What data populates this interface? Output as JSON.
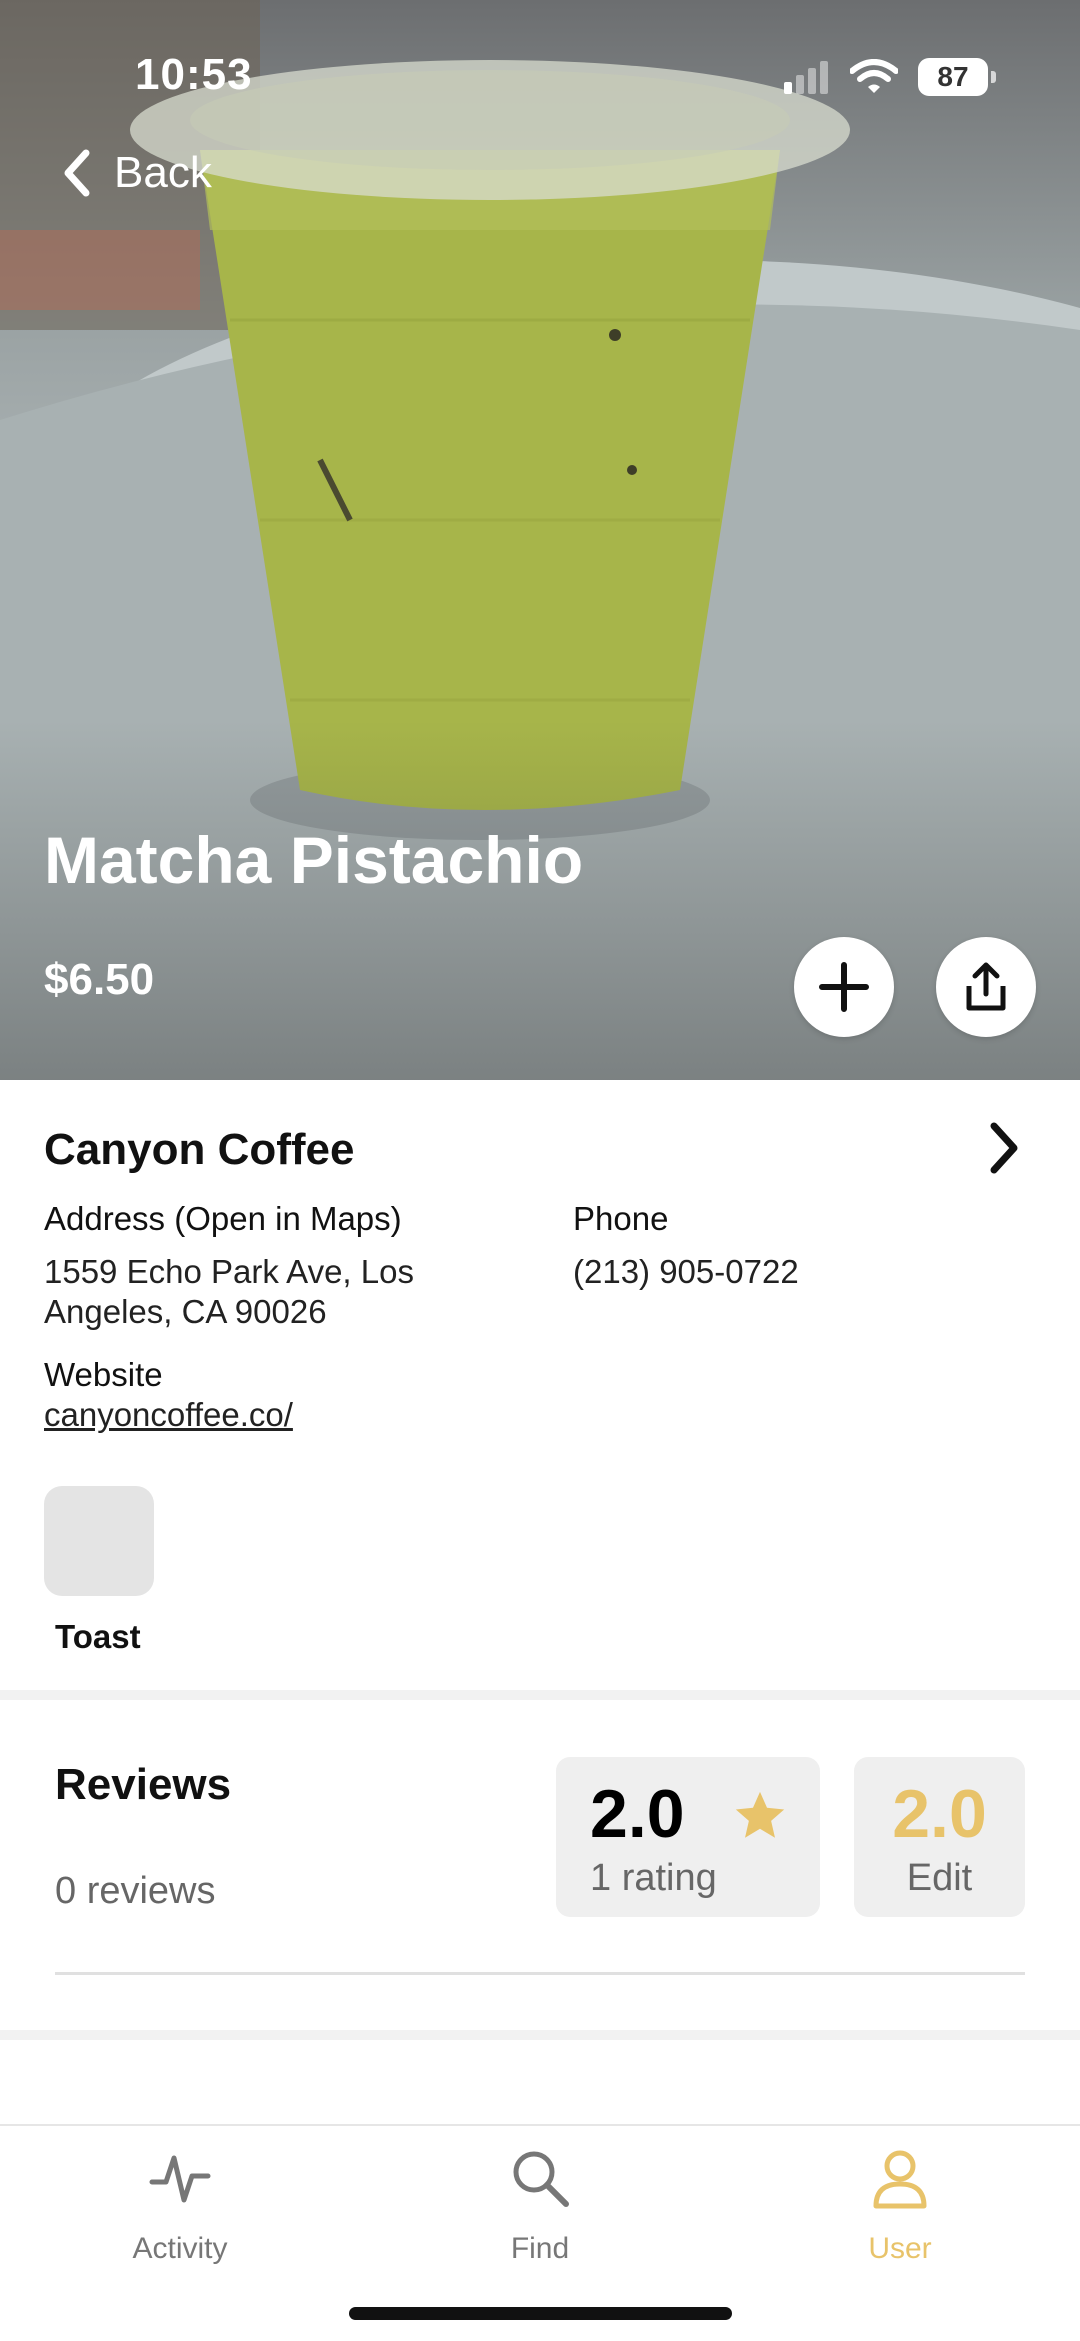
{
  "status_bar": {
    "time": "10:53",
    "battery": "87"
  },
  "nav": {
    "back_label": "Back"
  },
  "item": {
    "name": "Matcha Pistachio",
    "price": "$6.50"
  },
  "actions": {
    "add_icon": "plus-icon",
    "share_icon": "share-icon"
  },
  "shop": {
    "name": "Canyon Coffee",
    "address_label": "Address (Open in Maps)",
    "address_line1": "1559 Echo Park Ave, Los",
    "address_line2": "Angeles, CA 90026",
    "phone_label": "Phone",
    "phone": "(213) 905-0722",
    "website_label": "Website",
    "website": "canyoncoffee.co/"
  },
  "pos": {
    "name": "Toast"
  },
  "reviews": {
    "title": "Reviews",
    "count": "0 reviews",
    "rating_value": "2.0",
    "rating_count": "1 rating",
    "user_rating": "2.0",
    "edit_label": "Edit"
  },
  "tabs": [
    {
      "label": "Activity",
      "icon": "activity-icon"
    },
    {
      "label": "Find",
      "icon": "search-icon"
    },
    {
      "label": "User",
      "icon": "user-icon"
    }
  ],
  "colors": {
    "accent": "#e8c36a",
    "matcha": "#a7b54a"
  }
}
